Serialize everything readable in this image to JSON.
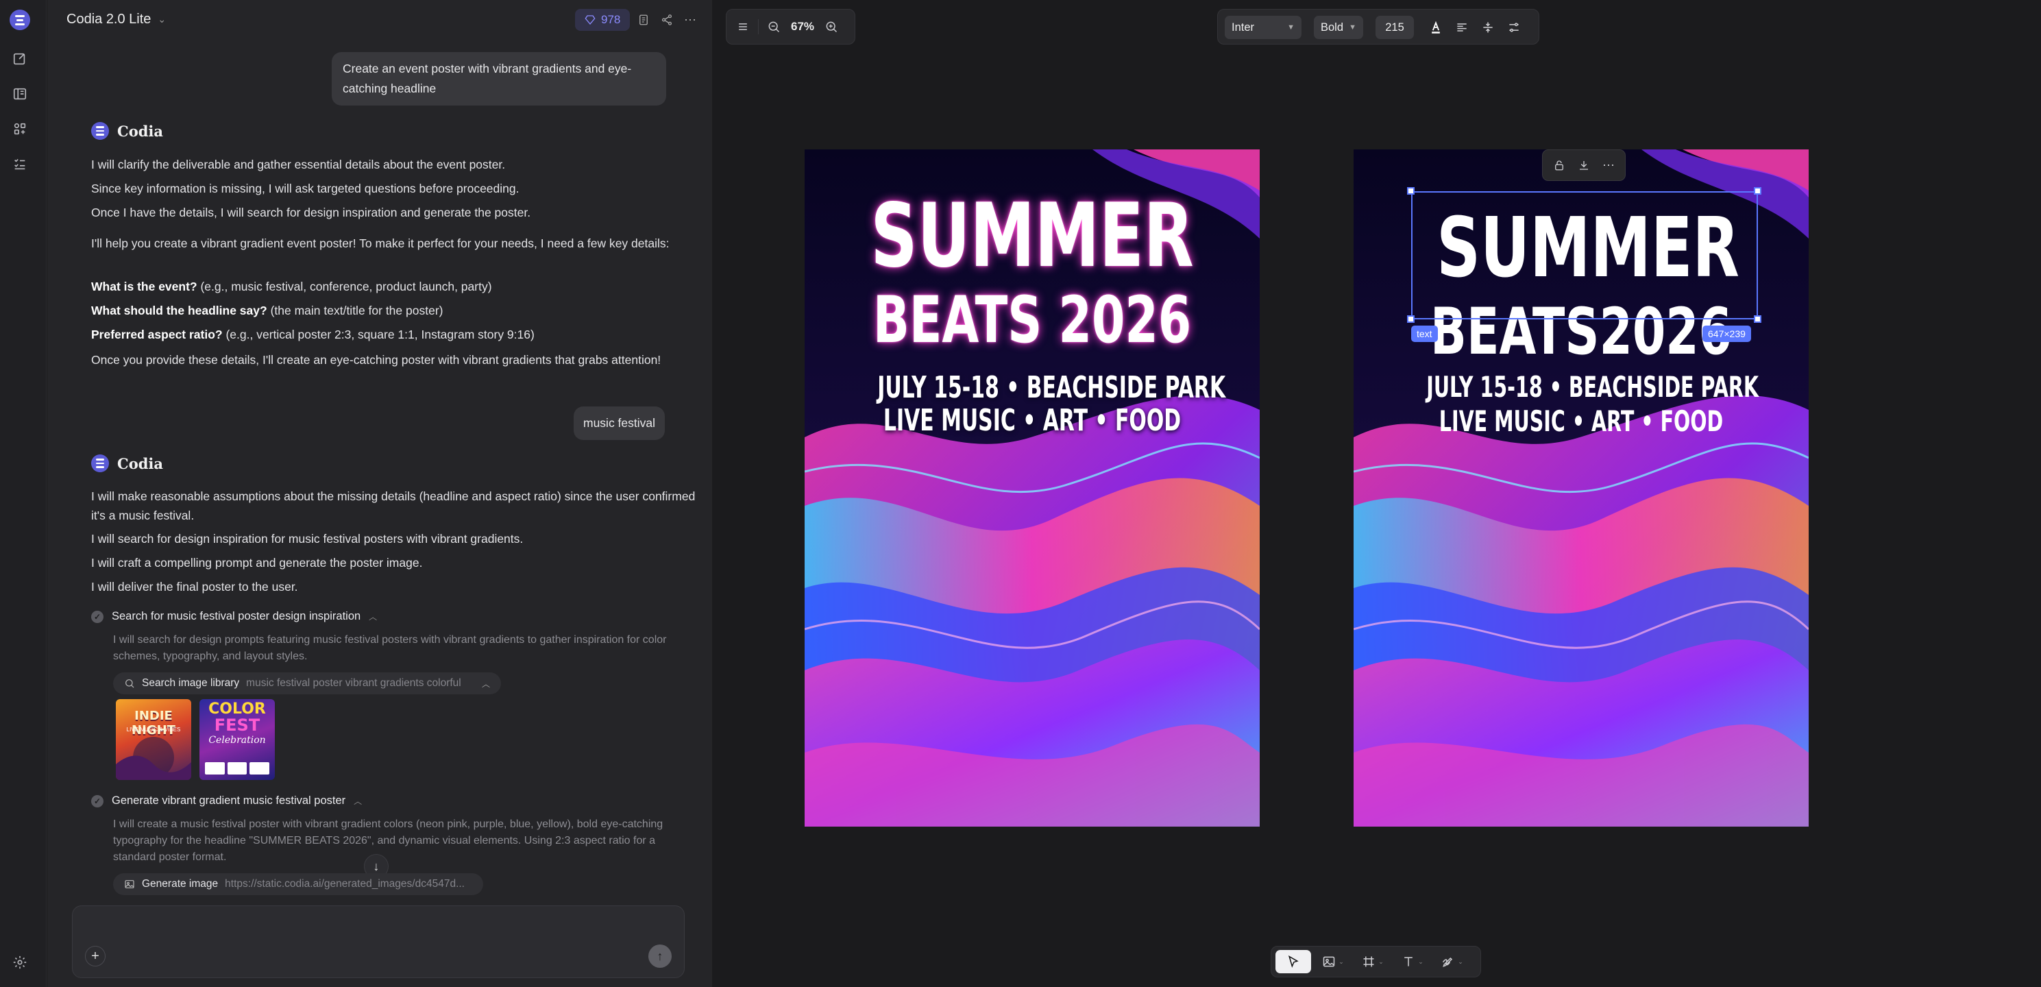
{
  "app": {
    "model_name": "Codia 2.0 Lite",
    "credits": "978"
  },
  "rail": {
    "icons": [
      "logo-icon",
      "new-chat-icon",
      "library-icon",
      "apps-icon",
      "tasks-icon",
      "settings-icon"
    ]
  },
  "chat": {
    "user_msg_1": "Create an event poster with vibrant gradients and eye-catching headline",
    "assistant_name": "Codia",
    "reply1": {
      "plan": [
        "I will clarify the deliverable and gather essential details about the event poster.",
        "Since key information is missing, I will ask targeted questions before proceeding.",
        "Once I have the details, I will search for design inspiration and generate the poster."
      ],
      "intro": "I'll help you create a vibrant gradient event poster! To make it perfect for your needs, I need a few key details:",
      "q1_bold": "What is the event?",
      "q1_rest": " (e.g., music festival, conference, product launch, party)",
      "q2_bold": "What should the headline say?",
      "q2_rest": " (the main text/title for the poster)",
      "q3_bold": "Preferred aspect ratio?",
      "q3_rest": " (e.g., vertical poster 2:3, square 1:1, Instagram story 9:16)",
      "outro": "Once you provide these details, I'll create an eye-catching poster with vibrant gradients that grabs attention!"
    },
    "user_msg_2": "music festival",
    "reply2": {
      "plan": [
        "I will make reasonable assumptions about the missing details (headline and aspect ratio) since the user confirmed it's a music festival.",
        "I will search for design inspiration for music festival posters with vibrant gradients.",
        "I will craft a compelling prompt and generate the poster image.",
        "I will deliver the final poster to the user."
      ],
      "step1_title": "Search for music festival poster design inspiration",
      "step1_desc": "I will search for design prompts featuring music festival posters with vibrant gradients to gather inspiration for color schemes, typography, and layout styles.",
      "tool1_label": "Search image library",
      "tool1_query": "music festival poster vibrant gradients colorful",
      "thumb1": {
        "line1": "INDIE NIGHT",
        "line2": "LIVE MUSIC & VIBES"
      },
      "thumb2": {
        "line1": "COLOR",
        "line2": "FEST",
        "line3": "Celebration"
      },
      "step2_title": "Generate vibrant gradient music festival poster",
      "step2_desc": "I will create a music festival poster with vibrant gradient colors (neon pink, purple, blue, yellow), bold eye-catching typography for the headline \"SUMMER BEATS 2026\", and dynamic visual elements. Using 2:3 aspect ratio for a standard poster format.",
      "tool2_label": "Generate image",
      "tool2_query": "https://static.codia.ai/generated_images/dc4547d..."
    },
    "composer_placeholder": ""
  },
  "canvas": {
    "zoom": "67%",
    "font_family": "Inter",
    "font_weight": "Bold",
    "font_size": "215",
    "poster1": {
      "line1": "SUMMER",
      "line2": "BEATS 2026",
      "line3": "JULY 15-18 • BEACHSIDE PARK",
      "line4": "LIVE MUSIC • ART • FOOD"
    },
    "poster2": {
      "line1": "SUMMER",
      "line2": "BEATS2026",
      "line3": "JULY 15-18 • BEACHSIDE PARK",
      "line4": "LIVE MUSIC • ART • FOOD"
    },
    "selection_label": "text",
    "selection_size": "647×239",
    "colors": {
      "accent": "#5a78ff",
      "brand": "#5b5bd6",
      "neon_pink": "#ff2fa8",
      "purple": "#8a2be2",
      "cyan": "#27c6ff"
    }
  }
}
